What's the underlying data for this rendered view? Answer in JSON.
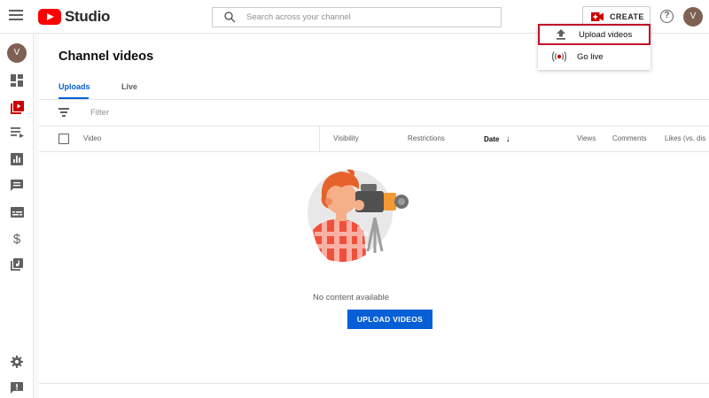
{
  "header": {
    "logo_text": "Studio",
    "search_placeholder": "Search across your channel",
    "create_label": "CREATE",
    "help_glyph": "?",
    "avatar_initial": "V"
  },
  "create_menu": {
    "items": [
      {
        "label": "Upload videos",
        "icon": "upload-icon",
        "highlighted": true
      },
      {
        "label": "Go live",
        "icon": "go-live-icon",
        "highlighted": false
      }
    ]
  },
  "sidebar": {
    "avatar_initial": "V",
    "items": [
      {
        "icon": "dashboard-icon"
      },
      {
        "icon": "content-icon",
        "active": true
      },
      {
        "icon": "playlists-icon"
      },
      {
        "icon": "analytics-icon"
      },
      {
        "icon": "comments-icon"
      },
      {
        "icon": "subtitles-icon"
      },
      {
        "icon": "monetization-icon"
      },
      {
        "icon": "audio-library-icon"
      },
      {
        "icon": "settings-icon"
      },
      {
        "icon": "feedback-icon"
      }
    ]
  },
  "main": {
    "title": "Channel videos",
    "tabs": [
      {
        "label": "Uploads",
        "active": true
      },
      {
        "label": "Live",
        "active": false
      }
    ],
    "filter_placeholder": "Filter",
    "columns": [
      {
        "label": "Video"
      },
      {
        "label": "Visibility"
      },
      {
        "label": "Restrictions"
      },
      {
        "label": "Date",
        "sorted": true
      },
      {
        "label": "Views"
      },
      {
        "label": "Comments"
      },
      {
        "label": "Likes (vs. dis"
      }
    ],
    "sort_glyph": "↓",
    "empty_text": "No content available",
    "upload_button_label": "UPLOAD VIDEOS"
  },
  "colors": {
    "accent_blue": "#065fd4",
    "brand_red": "#ff0000",
    "highlight_border": "#c0112a",
    "avatar_brown": "#7e6152"
  }
}
